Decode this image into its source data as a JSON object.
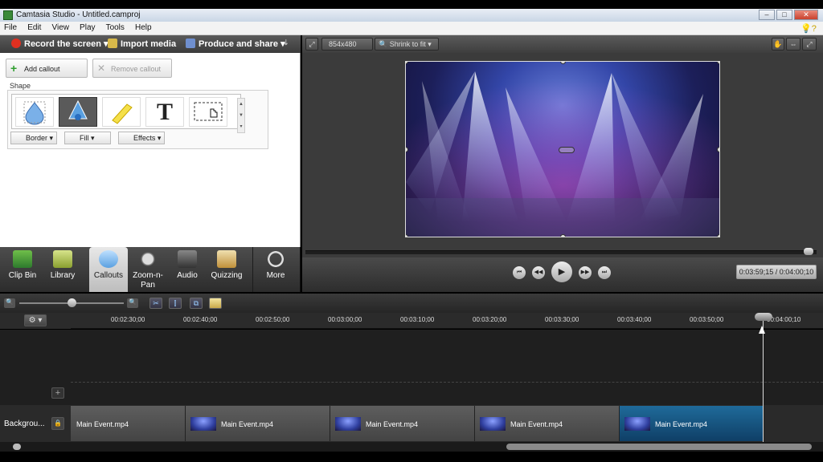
{
  "window": {
    "title": "Camtasia Studio - Untitled.camproj"
  },
  "menu": [
    "File",
    "Edit",
    "View",
    "Play",
    "Tools",
    "Help"
  ],
  "taskbar": {
    "record": "Record the screen",
    "import": "Import media",
    "produce": "Produce and share"
  },
  "callouts_panel": {
    "add_label": "Add callout",
    "remove_label": "Remove callout",
    "shape_label": "Shape",
    "border_label": "Border",
    "fill_label": "Fill",
    "effects_label": "Effects",
    "text_shape_glyph": "T"
  },
  "tabs": [
    {
      "label": "Clip Bin"
    },
    {
      "label": "Library"
    },
    {
      "label": "Callouts"
    },
    {
      "label": "Zoom-n-\nPan"
    },
    {
      "label": "Audio"
    },
    {
      "label": "Quizzing"
    },
    {
      "label": "More"
    }
  ],
  "preview": {
    "dimensions": "854x480",
    "fit": "Shrink to fit",
    "time": "0:03:59;15 / 0:04:00;10"
  },
  "timeline": {
    "ticks": [
      "00:02:30;00",
      "00:02:40;00",
      "00:02:50;00",
      "00:03:00;00",
      "00:03:10;00",
      "00:03:20;00",
      "00:03:30;00",
      "00:03:40;00",
      "00:03:50;00",
      "00:04:00;10"
    ],
    "track_label": "Backgrou...",
    "clips": [
      "Main Event.mp4",
      "Main Event.mp4",
      "Main Event.mp4",
      "Main Event.mp4",
      "Main Event.mp4"
    ]
  },
  "colors": {
    "accent_selected_clip": "#1f6a9a",
    "record_dot": "#e03020"
  }
}
